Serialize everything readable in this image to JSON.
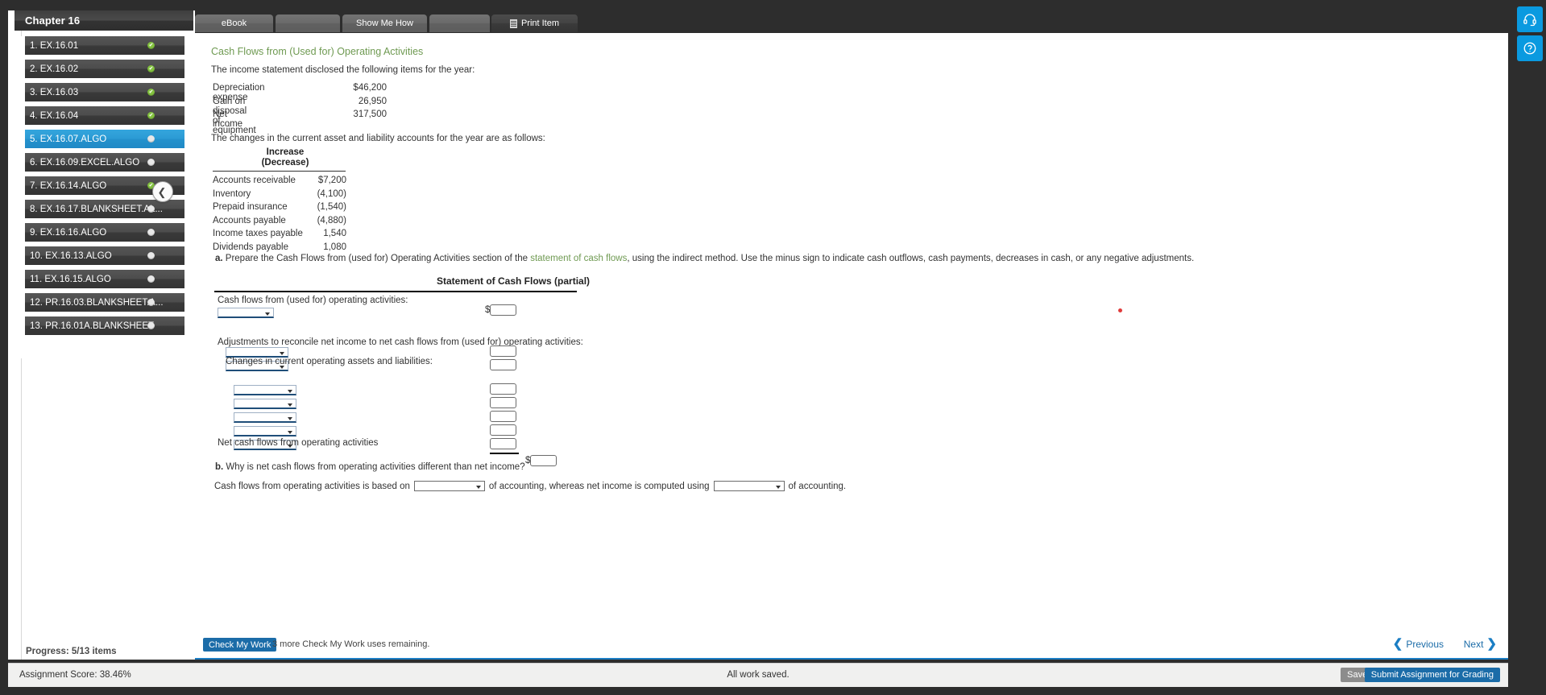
{
  "sidebar": {
    "chapter_title": "Chapter 16",
    "progress_label": "Progress:  5/13 items",
    "items": [
      {
        "label": "1. EX.16.01",
        "status": "done"
      },
      {
        "label": "2. EX.16.02",
        "status": "done"
      },
      {
        "label": "3. EX.16.03",
        "status": "done"
      },
      {
        "label": "4. EX.16.04",
        "status": "done"
      },
      {
        "label": "5. EX.16.07.ALGO",
        "status": "current"
      },
      {
        "label": "6. EX.16.09.EXCEL.ALGO",
        "status": "todo"
      },
      {
        "label": "7. EX.16.14.ALGO",
        "status": "done"
      },
      {
        "label": "8. EX.16.17.BLANKSHEET.AL...",
        "status": "todo"
      },
      {
        "label": "9. EX.16.16.ALGO",
        "status": "todo"
      },
      {
        "label": "10. EX.16.13.ALGO",
        "status": "todo"
      },
      {
        "label": "11. EX.16.15.ALGO",
        "status": "todo"
      },
      {
        "label": "12. PR.16.03.BLANKSHEET.A...",
        "status": "todo"
      },
      {
        "label": "13. PR.16.01A.BLANKSHEET",
        "status": "todo"
      }
    ]
  },
  "tabs": {
    "ebook": "eBook",
    "gap1": "",
    "show_me_how": "Show Me How",
    "gap2": "",
    "print_item": "Print Item"
  },
  "content": {
    "heading": "Cash Flows from (Used for) Operating Activities",
    "intro": "The income statement disclosed the following items for the year:",
    "income_items": [
      {
        "label": "Depreciation expense",
        "value": "$46,200"
      },
      {
        "label": "Gain on disposal of equipment",
        "value": "26,950"
      },
      {
        "label": "Net income",
        "value": "317,500"
      }
    ],
    "changes_intro": "The changes in the current asset and liability accounts for the year are as follows:",
    "changes_header_line1": "Increase",
    "changes_header_line2": "(Decrease)",
    "changes_items": [
      {
        "label": "Accounts receivable",
        "value": "$7,200"
      },
      {
        "label": "Inventory",
        "value": "(4,100)"
      },
      {
        "label": "Prepaid insurance",
        "value": "(1,540)"
      },
      {
        "label": "Accounts payable",
        "value": "(4,880)"
      },
      {
        "label": "Income taxes payable",
        "value": "1,540"
      },
      {
        "label": "Dividends payable",
        "value": "1,080"
      }
    ],
    "part_a": {
      "marker": "a.",
      "text_before_link": " Prepare the Cash Flows from (used for) Operating Activities section of the ",
      "link_text": "statement of cash flows",
      "text_after_link": ", using the indirect method. Use the minus sign to indicate cash outflows, cash payments, decreases in cash, or any negative adjustments."
    },
    "statement": {
      "title": "Statement of Cash Flows (partial)",
      "row_cash_flows": "Cash flows from (used for) operating activities:",
      "row_adjustments": "Adjustments to reconcile net income to net cash flows from (used for) operating activities:",
      "row_changes": "Changes in current operating assets and liabilities:",
      "row_net": "Net cash flows from operating activities",
      "dollar_sign": "$",
      "select_placeholder": "",
      "amount_placeholder": ""
    },
    "part_b": {
      "marker": "b.",
      "question": " Why is net cash flows from operating activities different than net income?",
      "sentence_part1": "Cash flows from operating activities is based on",
      "sentence_part2": "of accounting, whereas net income is computed using",
      "sentence_part3": "of accounting.",
      "select1_value": "",
      "select2_value": ""
    }
  },
  "action_bar": {
    "check_my_work": "Check My Work",
    "check_note": "3 more Check My Work uses remaining.",
    "previous": "Previous",
    "next": "Next",
    "prev_chevron": "❮",
    "next_chevron": "❯"
  },
  "status_bar": {
    "score_label": "Assignment Score:  38.46%",
    "saved_text": "All work saved.",
    "save_and_exit": "Save and Exit",
    "submit": "Submit Assignment for Grading"
  },
  "utility": {
    "headset_icon": "headset-icon",
    "help_icon": "help-icon"
  },
  "colors": {
    "accent_blue": "#1b6ca8",
    "active_nav": "#2b9ad4",
    "heading_green": "#6f9a52",
    "done_green": "#84c340"
  }
}
